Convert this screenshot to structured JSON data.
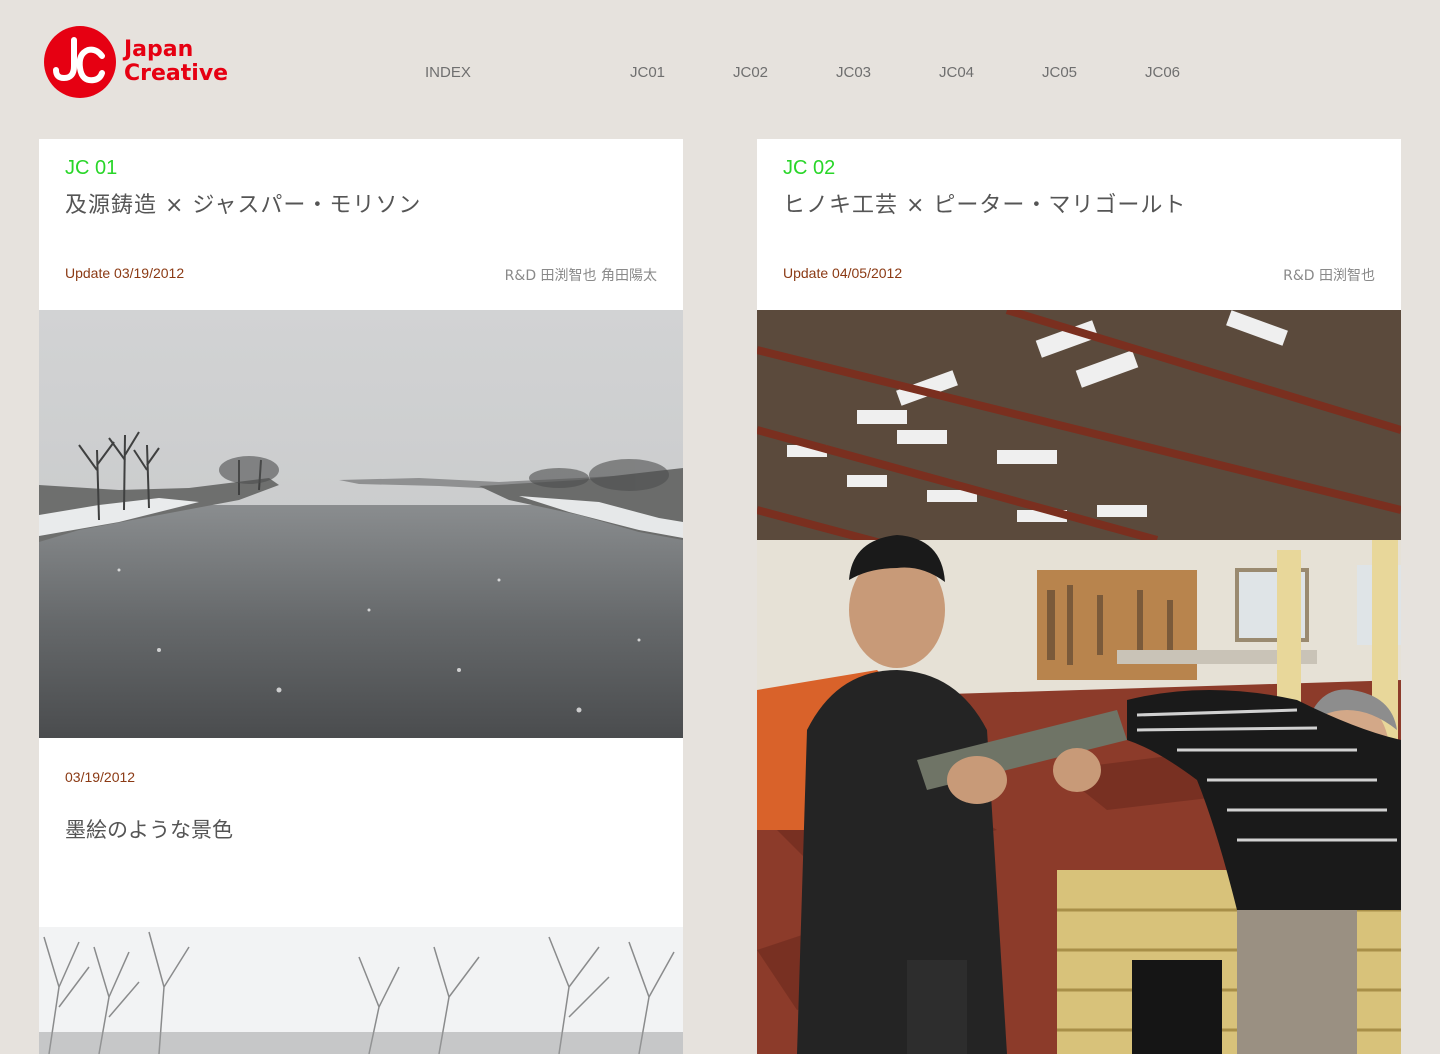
{
  "brand": {
    "line1": "Japan",
    "line2": "Creative",
    "color": "#e60012"
  },
  "nav": [
    {
      "label": "INDEX"
    },
    {
      "label": "JC01"
    },
    {
      "label": "JC02"
    },
    {
      "label": "JC03"
    },
    {
      "label": "JC04"
    },
    {
      "label": "JC05"
    },
    {
      "label": "JC06"
    }
  ],
  "cards": [
    {
      "jc": "JC 01",
      "title": "及源鋳造 × ジャスパー・モリソン",
      "update": "Update 03/19/2012",
      "credit": "R&D 田渕智也 角田陽太",
      "post": {
        "date": "03/19/2012",
        "title": "墨絵のような景色"
      }
    },
    {
      "jc": "JC 02",
      "title": "ヒノキ工芸 × ピーター・マリゴールト",
      "update": "Update 04/05/2012",
      "credit": "R&D 田渕智也"
    }
  ],
  "colors": {
    "background": "#e6e2dd",
    "label_green": "#29d629",
    "update_brown": "#8b3a14"
  }
}
